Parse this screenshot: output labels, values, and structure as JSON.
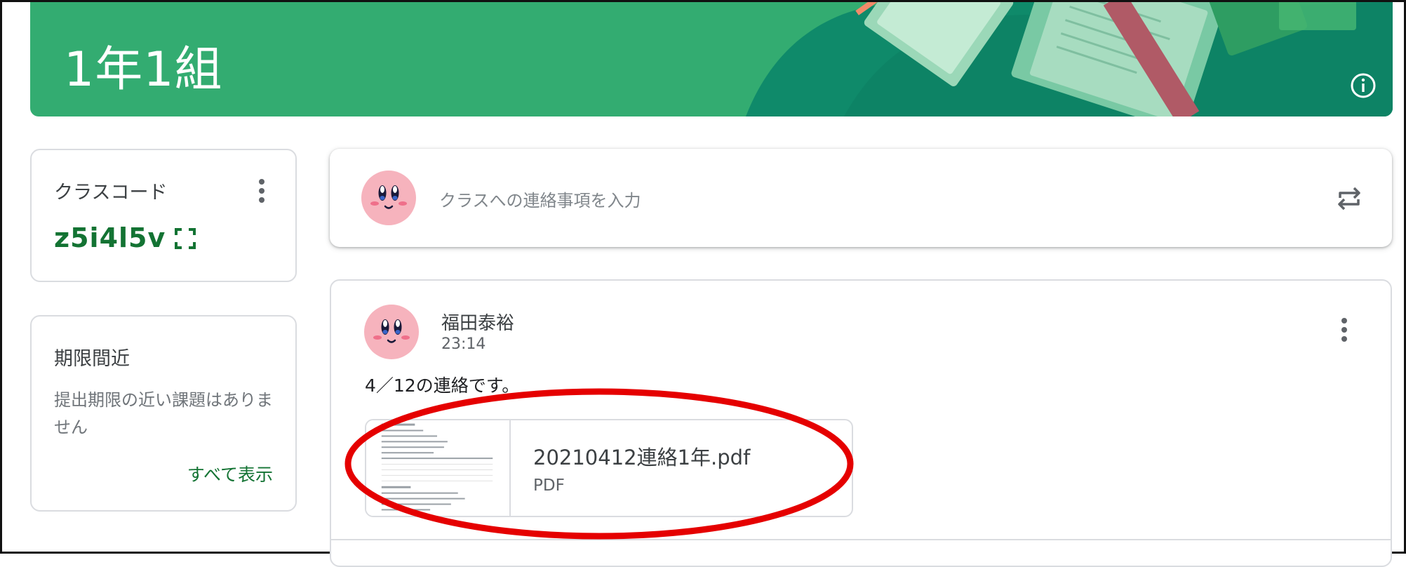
{
  "banner": {
    "title": "1年1組",
    "color": "#33ac71"
  },
  "class_code": {
    "label": "クラスコード",
    "value": "z5i4l5v"
  },
  "upcoming": {
    "label": "期限間近",
    "empty_text": "提出期限の近い課題はありません",
    "view_all": "すべて表示"
  },
  "compose": {
    "placeholder": "クラスへの連絡事項を入力"
  },
  "post": {
    "author": "福田泰裕",
    "time": "23:14",
    "body": "4／12の連絡です。",
    "attachment": {
      "name": "20210412連絡1年.pdf",
      "type": "PDF"
    }
  },
  "colors": {
    "accent_green": "#137333",
    "annotation_red": "#e50000"
  },
  "icons": {
    "info": "info-icon",
    "more": "more-vert-icon",
    "expand": "fullscreen-icon",
    "repost": "repost-icon",
    "avatar": "kirby-avatar"
  }
}
